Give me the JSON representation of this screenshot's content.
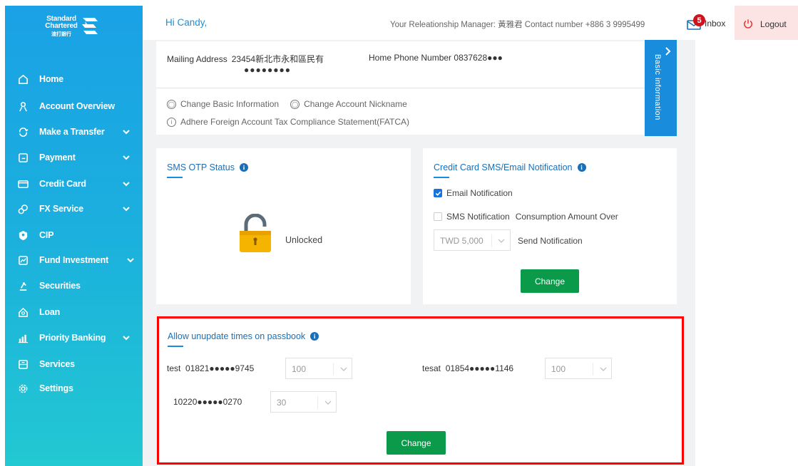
{
  "brand": {
    "line1": "Standard",
    "line2": "Chartered",
    "cn": "渣打銀行"
  },
  "sidebar": {
    "items": [
      {
        "label": "Home",
        "icon": "home-icon",
        "has_chevron": false
      },
      {
        "label": "Account Overview",
        "icon": "person-icon",
        "has_chevron": false
      },
      {
        "label": "Make a Transfer",
        "icon": "transfer-icon",
        "has_chevron": true
      },
      {
        "label": "Payment",
        "icon": "payment-icon",
        "has_chevron": true
      },
      {
        "label": "Credit Card",
        "icon": "credit-card-icon",
        "has_chevron": true
      },
      {
        "label": "FX Service",
        "icon": "fx-icon",
        "has_chevron": true
      },
      {
        "label": "CIP",
        "icon": "cip-icon",
        "has_chevron": false
      },
      {
        "label": "Fund Investment",
        "icon": "fund-icon",
        "has_chevron": true
      },
      {
        "label": "Securities",
        "icon": "securities-icon",
        "has_chevron": false
      },
      {
        "label": "Loan",
        "icon": "loan-icon",
        "has_chevron": false
      },
      {
        "label": "Priority Banking",
        "icon": "priority-banking-icon",
        "has_chevron": true
      },
      {
        "label": "Services",
        "icon": "services-icon",
        "has_chevron": false
      },
      {
        "label": "Settings",
        "icon": "settings-icon",
        "has_chevron": false
      }
    ]
  },
  "header": {
    "greeting": "Hi Candy,",
    "rm_text": "Your Releationship Manager: 黃雅君 Contact number +886 3 9995499",
    "inbox_label": "Inbox",
    "inbox_count": "5",
    "logout_label": "Logout"
  },
  "basic_info": {
    "mailing_label": "Mailing Address",
    "mailing_value": "23454新北市永和區民有",
    "mailing_value2": "●●●●●●●●",
    "home_phone_label": "Home Phone Number",
    "home_phone_value": "0837628●●●",
    "link_change_basic": "Change Basic Information",
    "link_change_nickname": "Change Account Nickname",
    "link_fatca": "Adhere Foreign Account Tax Compliance Statement(FATCA)",
    "tab_label": "Basic information"
  },
  "sms_otp": {
    "title": "SMS OTP Status",
    "status": "Unlocked"
  },
  "cc_notification": {
    "title": "Credit Card SMS/Email Notification",
    "email_label": "Email Notification",
    "email_checked": true,
    "sms_label": "SMS Notification",
    "consumption_label": "Consumption Amount Over",
    "amount_selected": "TWD 5,000",
    "send_label": "Send Notification",
    "button": "Change"
  },
  "passbook": {
    "title": "Allow unupdate times on passbook",
    "accounts": [
      {
        "name": "test",
        "number": "01821●●●●●9745",
        "value": "100"
      },
      {
        "name": "tesat",
        "number": "01854●●●●●1146",
        "value": "100"
      },
      {
        "name": "",
        "number": "10220●●●●●0270",
        "value": "30"
      }
    ],
    "button": "Change"
  }
}
